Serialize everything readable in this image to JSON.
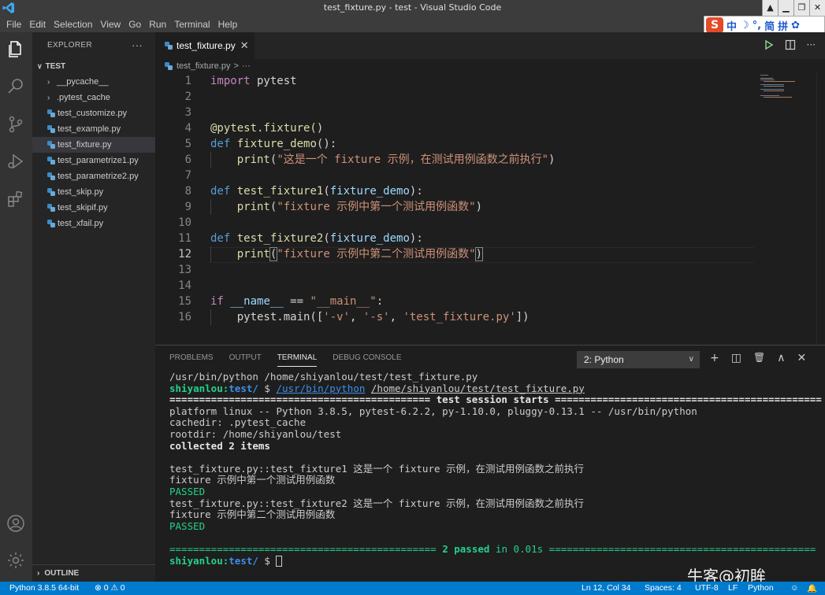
{
  "window": {
    "title": "test_fixture.py - test - Visual Studio Code",
    "controls": [
      "▲",
      "▁",
      "❐",
      "✕"
    ]
  },
  "menu": [
    "File",
    "Edit",
    "Selection",
    "View",
    "Go",
    "Run",
    "Terminal",
    "Help"
  ],
  "ime": {
    "logo": "S",
    "items": [
      "中",
      "☽",
      "°,",
      "简",
      "拼",
      "✿"
    ]
  },
  "sidebar": {
    "header": "EXPLORER",
    "more": "···",
    "section": "TEST",
    "items": [
      {
        "label": "__pycache__",
        "type": "folder"
      },
      {
        "label": ".pytest_cache",
        "type": "folder"
      },
      {
        "label": "test_customize.py",
        "type": "file"
      },
      {
        "label": "test_example.py",
        "type": "file"
      },
      {
        "label": "test_fixture.py",
        "type": "file",
        "selected": true
      },
      {
        "label": "test_parametrize1.py",
        "type": "file"
      },
      {
        "label": "test_parametrize2.py",
        "type": "file"
      },
      {
        "label": "test_skip.py",
        "type": "file"
      },
      {
        "label": "test_skipif.py",
        "type": "file"
      },
      {
        "label": "test_xfail.py",
        "type": "file"
      }
    ],
    "outline": "OUTLINE"
  },
  "editor": {
    "tab": "test_fixture.py",
    "breadcrumb": {
      "file": "test_fixture.py",
      "sep": ">",
      "more": "···"
    },
    "current_line": 12,
    "lines": [
      "1",
      "2",
      "3",
      "4",
      "5",
      "6",
      "7",
      "8",
      "9",
      "10",
      "11",
      "12",
      "13",
      "14",
      "15",
      "16"
    ],
    "code": {
      "l1_kw": "import",
      "l1_rest": " pytest",
      "l4": "@pytest.fixture()",
      "l5_kw": "def",
      "l5_fn": "fixture_demo",
      "l5_rest": "():",
      "l6_fn": "print",
      "l6_p1": "(",
      "l6_str": "\"这是一个 fixture 示例，在测试用例函数之前执行\"",
      "l6_p2": ")",
      "l8_kw": "def",
      "l8_fn": "test_fixture1",
      "l8_p1": "(",
      "l8_var": "fixture_demo",
      "l8_p2": "):",
      "l9_fn": "print",
      "l9_p1": "(",
      "l9_str": "\"fixture 示例中第一个测试用例函数\"",
      "l9_p2": ")",
      "l11_kw": "def",
      "l11_fn": "test_fixture2",
      "l11_p1": "(",
      "l11_var": "fixture_demo",
      "l11_p2": "):",
      "l12_fn": "print",
      "l12_p1": "(",
      "l12_str": "\"fixture 示例中第二个测试用例函数\"",
      "l12_p2": ")",
      "l15_kw": "if",
      "l15_var": "__name__",
      "l15_op": " == ",
      "l15_str": "\"__main__\"",
      "l15_rest": ":",
      "l16_a": "pytest.main([",
      "l16_s1": "'-v'",
      "l16_c1": ", ",
      "l16_s2": "'-s'",
      "l16_c2": ", ",
      "l16_s3": "'test_fixture.py'",
      "l16_b": "])"
    }
  },
  "panel": {
    "tabs": [
      "PROBLEMS",
      "OUTPUT",
      "TERMINAL",
      "DEBUG CONSOLE"
    ],
    "active_tab": "TERMINAL",
    "terminal_select": "2: Python",
    "tools": [
      "+",
      "◫",
      "🗑",
      "∧",
      "✕"
    ]
  },
  "terminal": {
    "l1": "/usr/bin/python /home/shiyanlou/test/test_fixture.py",
    "l2_user": "shiyanlou:",
    "l2_dir": "test/",
    "l2_prompt": " $ ",
    "l2_cmd1": "/usr/bin/python",
    "l2_sp": " ",
    "l2_cmd2": "/home/shiyanlou/test/test_fixture.py",
    "l3": "============================================ test session starts =============================================",
    "l4": "platform linux -- Python 3.8.5, pytest-6.2.2, py-1.10.0, pluggy-0.13.1 -- /usr/bin/python",
    "l5": "cachedir: .pytest_cache",
    "l6": "rootdir: /home/shiyanlou/test",
    "l7": "collected 2 items",
    "l9": "test_fixture.py::test_fixture1 这是一个 fixture 示例，在测试用例函数之前执行",
    "l10": "fixture 示例中第一个测试用例函数",
    "l11": "PASSED",
    "l12": "test_fixture.py::test_fixture2 这是一个 fixture 示例，在测试用例函数之前执行",
    "l13": "fixture 示例中第二个测试用例函数",
    "l14": "PASSED",
    "l16_a": "============================================= ",
    "l16_b": "2 passed",
    "l16_c": " in 0.01s",
    "l16_d": " =============================================",
    "l17_user": "shiyanlou:",
    "l17_dir": "test/",
    "l17_prompt": " $ "
  },
  "status": {
    "python": "Python 3.8.5 64-bit",
    "problems": "⊗ 0 ⚠ 0",
    "position": "Ln 12, Col 34",
    "spaces": "Spaces: 4",
    "encoding": "UTF-8",
    "eol": "LF",
    "lang": "Python"
  },
  "watermark": "牛客@初眸",
  "colors": {
    "accent": "#007acc",
    "keyword": "#569cd6",
    "function": "#dcdcaa",
    "string": "#ce9178",
    "variable": "#9cdcfe",
    "terminal_green": "#23d18b",
    "terminal_blue": "#3b8eea"
  }
}
